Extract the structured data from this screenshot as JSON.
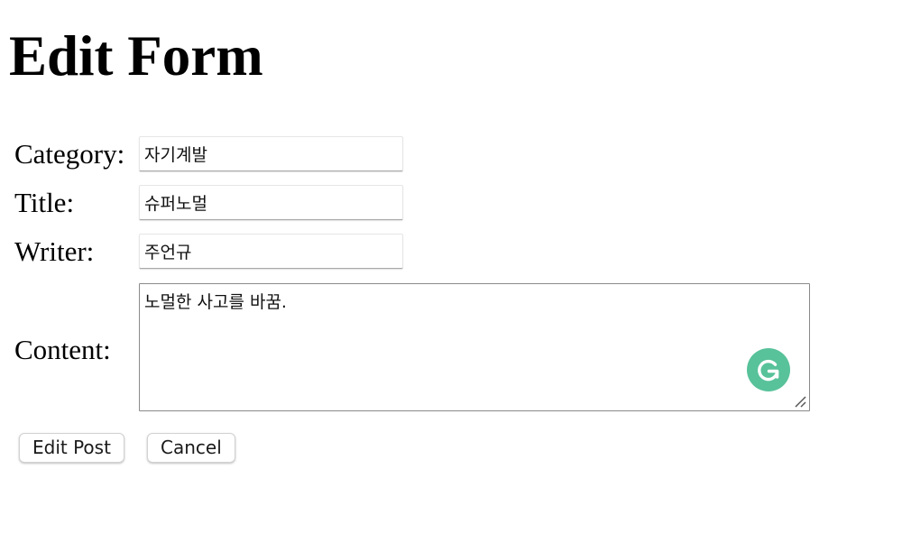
{
  "page": {
    "title": "Edit Form"
  },
  "form": {
    "category": {
      "label": "Category:",
      "value": "자기계발"
    },
    "title": {
      "label": "Title:",
      "value": "슈퍼노멀"
    },
    "writer": {
      "label": "Writer:",
      "value": "주언규"
    },
    "content": {
      "label": "Content:",
      "value": "노멀한 사고를 바꿈."
    }
  },
  "buttons": {
    "edit_label": "Edit Post",
    "cancel_label": "Cancel"
  },
  "icons": {
    "grammarly": "grammarly-icon",
    "resize": "resize-grip-icon"
  },
  "colors": {
    "grammarly": "#58c29a"
  }
}
